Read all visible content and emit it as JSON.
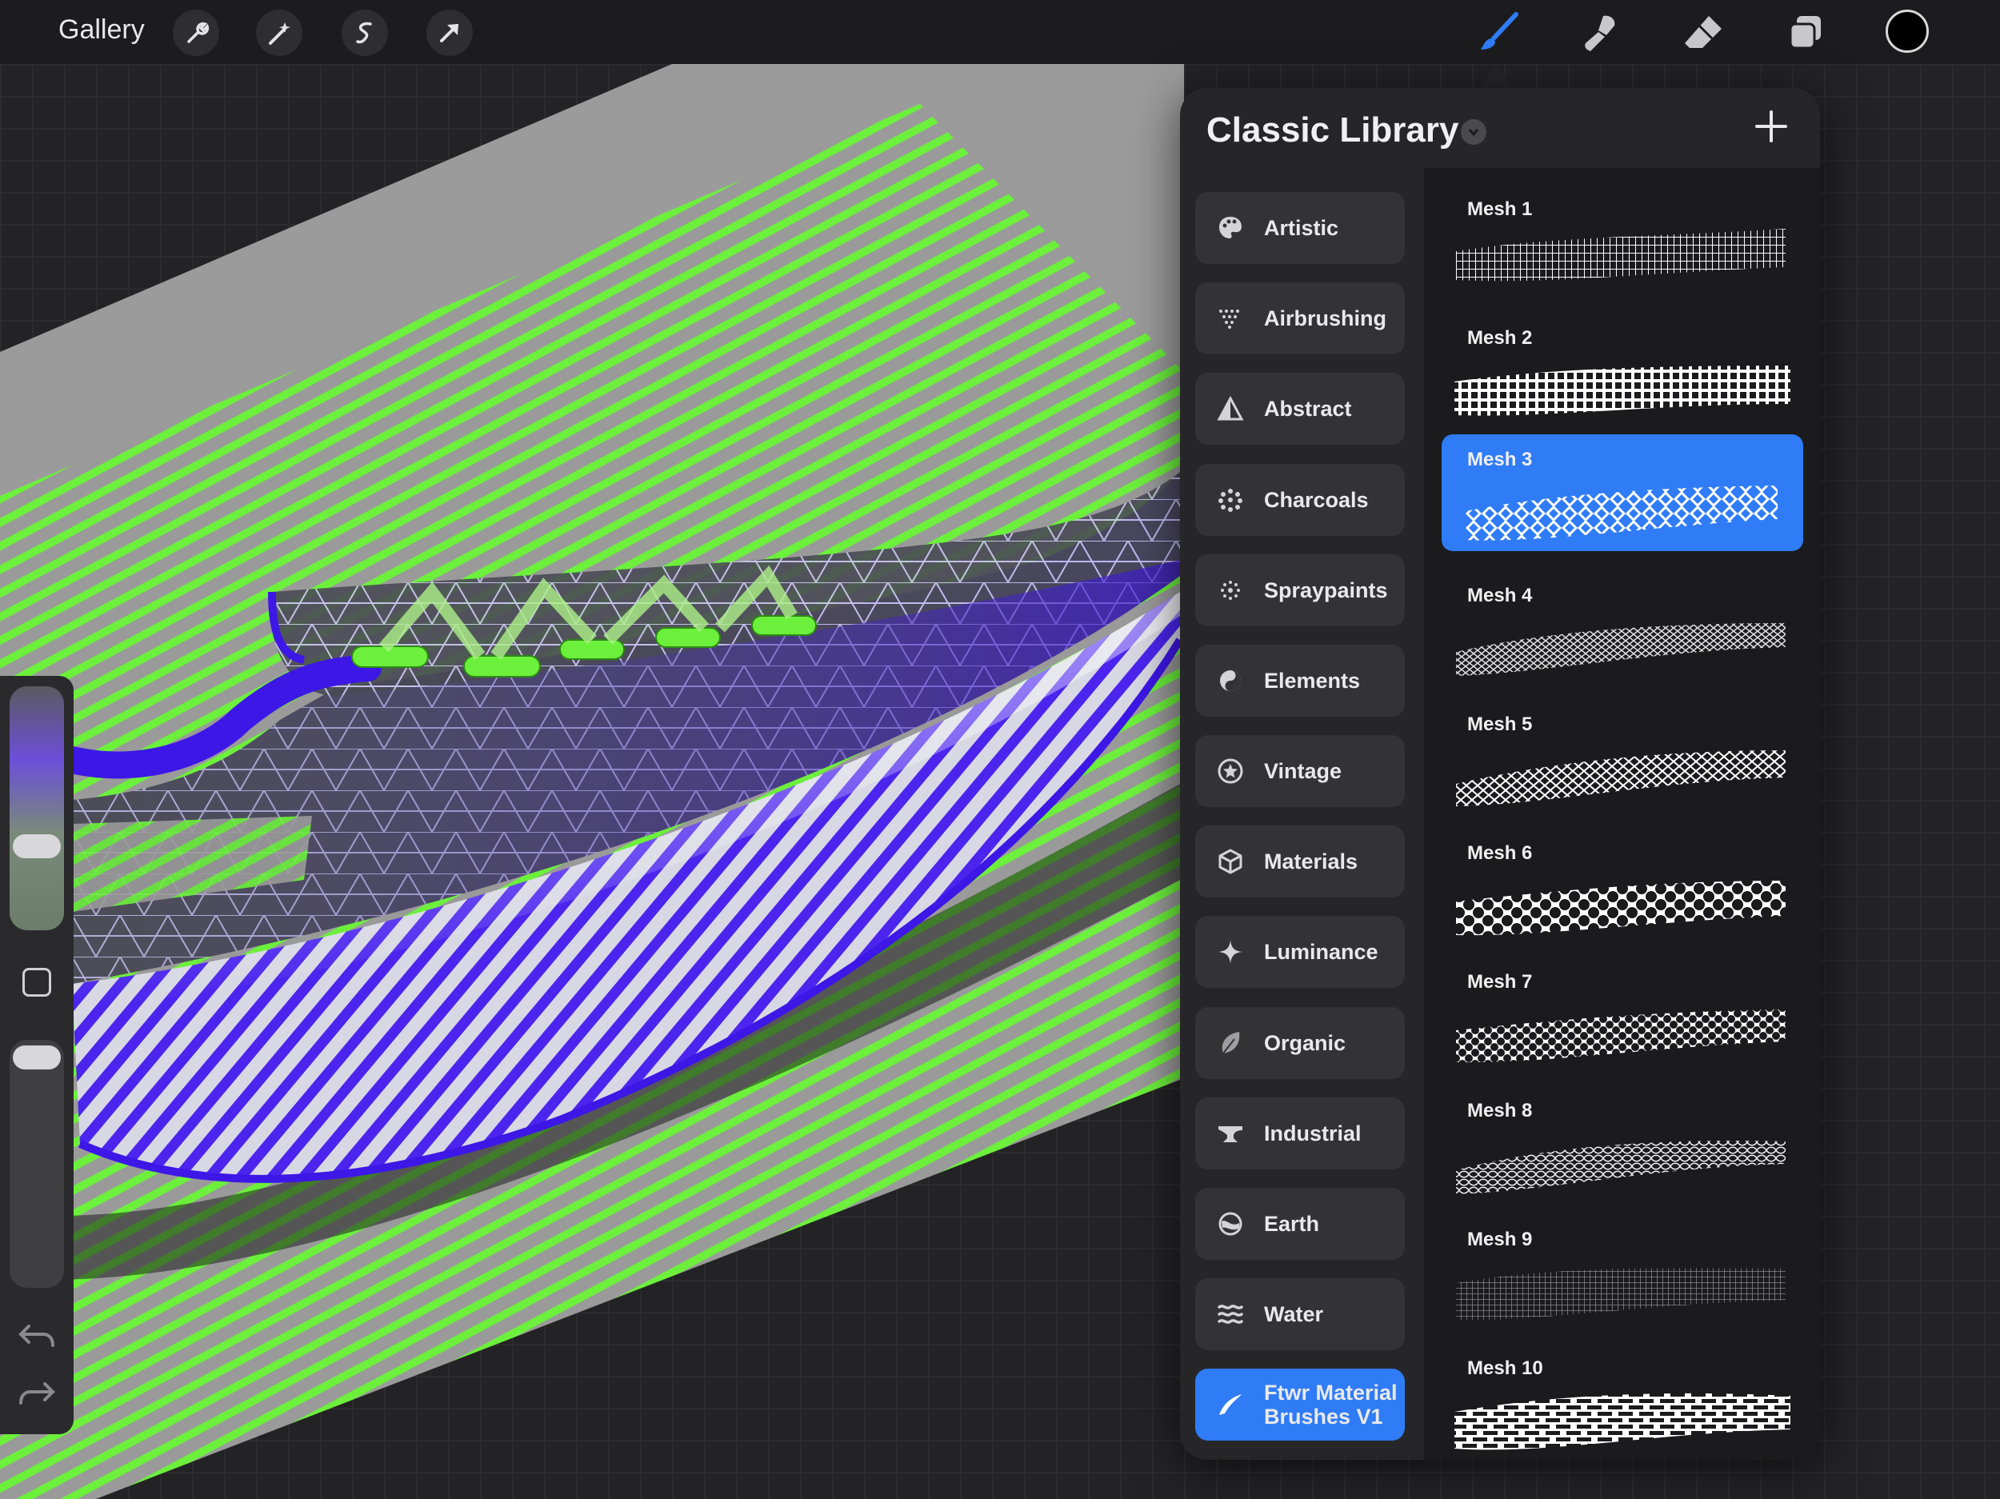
{
  "toolbar": {
    "gallery_label": "Gallery",
    "left_tools": [
      "wrench-icon",
      "magic-wand-icon",
      "selection-icon",
      "move-arrow-icon"
    ],
    "right_tools": [
      "brush-icon",
      "smudge-icon",
      "eraser-icon",
      "layers-icon"
    ],
    "current_color": "#000000"
  },
  "panel": {
    "title": "Classic Library",
    "categories": [
      {
        "label": "Artistic",
        "icon": "palette-icon"
      },
      {
        "label": "Airbrushing",
        "icon": "airbrush-icon"
      },
      {
        "label": "Abstract",
        "icon": "triangle-icon"
      },
      {
        "label": "Charcoals",
        "icon": "charcoal-icon"
      },
      {
        "label": "Spraypaints",
        "icon": "spray-icon"
      },
      {
        "label": "Elements",
        "icon": "yin-yang-icon"
      },
      {
        "label": "Vintage",
        "icon": "star-badge-icon"
      },
      {
        "label": "Materials",
        "icon": "cube-icon"
      },
      {
        "label": "Luminance",
        "icon": "sparkle-icon"
      },
      {
        "label": "Organic",
        "icon": "leaf-icon"
      },
      {
        "label": "Industrial",
        "icon": "anvil-icon"
      },
      {
        "label": "Earth",
        "icon": "earth-icon"
      },
      {
        "label": "Water",
        "icon": "waves-icon"
      },
      {
        "label": "Ftwr Material Brushes V1",
        "label_line1": "Ftwr Material",
        "label_line2": "Brushes V1",
        "icon": "brush-stroke-icon",
        "active": true
      }
    ],
    "brushes": [
      {
        "name": "Mesh 1",
        "pattern": "grid-fine"
      },
      {
        "name": "Mesh 2",
        "pattern": "grid"
      },
      {
        "name": "Mesh 3",
        "pattern": "hex-diamond",
        "selected": true
      },
      {
        "name": "Mesh 4",
        "pattern": "diamond-fine"
      },
      {
        "name": "Mesh 5",
        "pattern": "diamond"
      },
      {
        "name": "Mesh 6",
        "pattern": "hex-large"
      },
      {
        "name": "Mesh 7",
        "pattern": "hex-small"
      },
      {
        "name": "Mesh 8",
        "pattern": "wave-net"
      },
      {
        "name": "Mesh 9",
        "pattern": "grid-faint"
      },
      {
        "name": "Mesh 10",
        "pattern": "brick"
      }
    ]
  },
  "colors": {
    "accent": "#2f7cf6",
    "stripe_green": "#6cf03c",
    "shoe_purple": "#3d17e6"
  }
}
